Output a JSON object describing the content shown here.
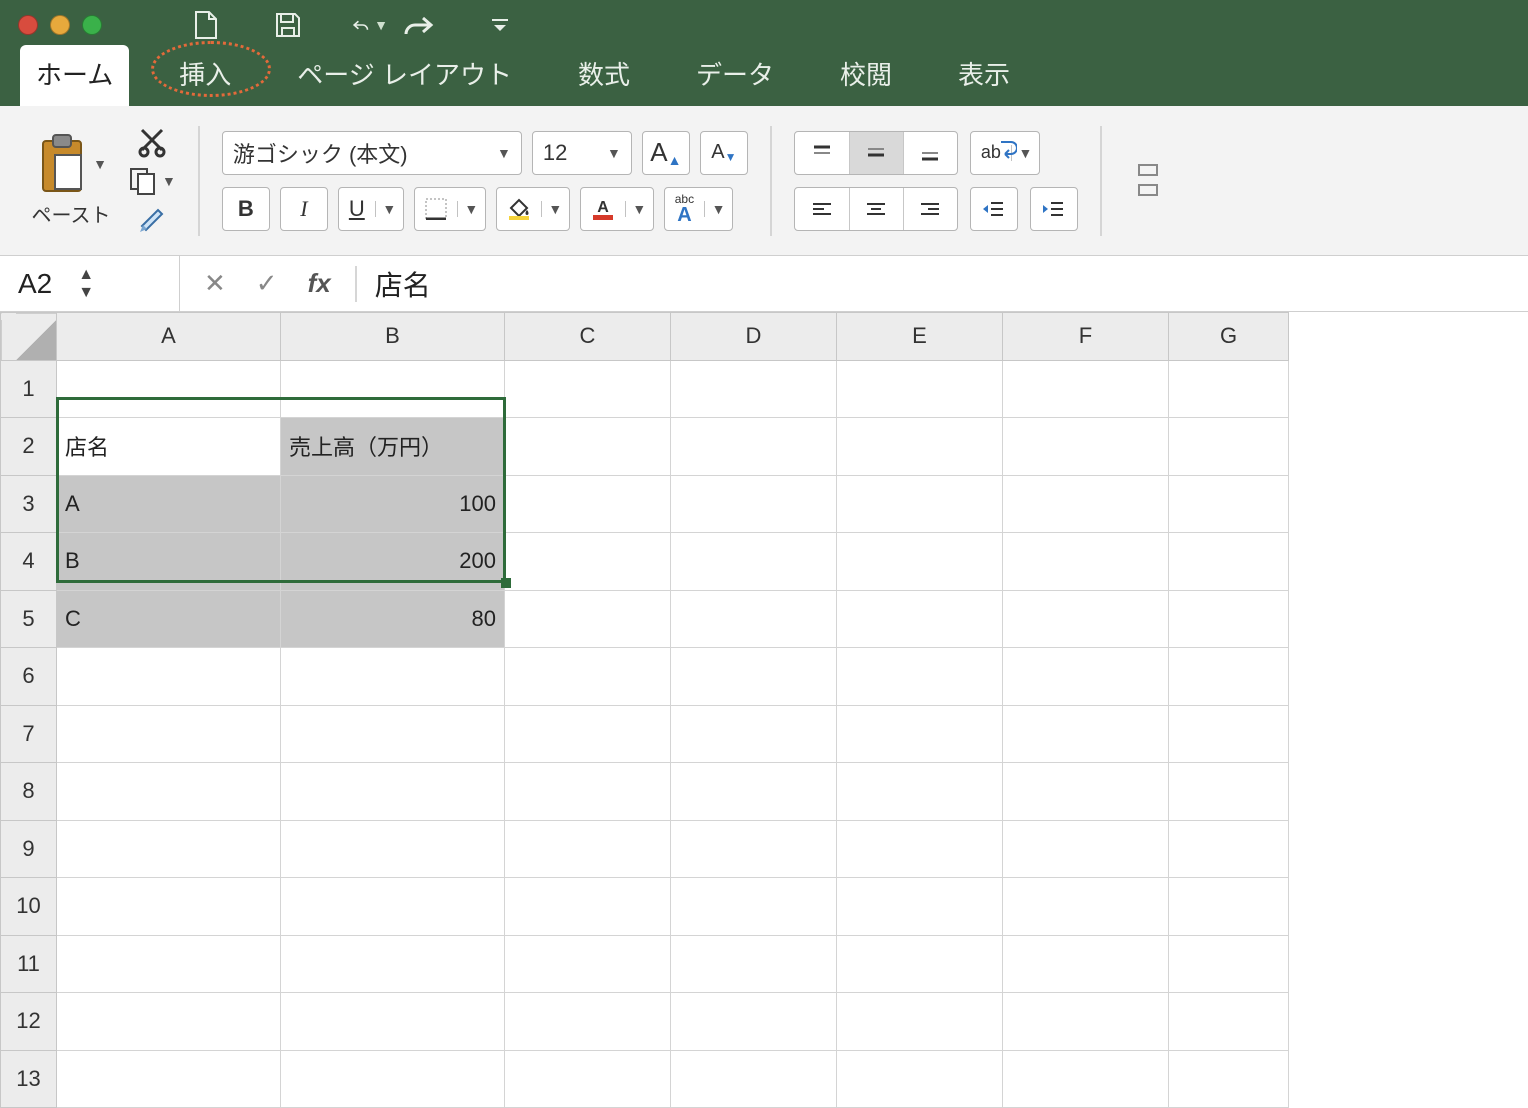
{
  "quick_access": {
    "new_icon": "new-file",
    "save_icon": "save",
    "undo_icon": "undo",
    "redo_icon": "redo",
    "customize_icon": "customize"
  },
  "tabs": {
    "home": "ホーム",
    "insert": "挿入",
    "page_layout": "ページ レイアウト",
    "formulas": "数式",
    "data": "データ",
    "review": "校閲",
    "view": "表示"
  },
  "ribbon": {
    "paste_label": "ペースト",
    "font_name": "游ゴシック (本文)",
    "font_size": "12",
    "bold": "B",
    "italic": "I",
    "underline": "U",
    "grow_font": "A",
    "shrink_font": "A",
    "phonetic": "abc",
    "phonetic_sub": "A",
    "wrap_text": "ab"
  },
  "name_box": "A2",
  "formula_bar": "店名",
  "columns": [
    "A",
    "B",
    "C",
    "D",
    "E",
    "F",
    "G"
  ],
  "rows": [
    "1",
    "2",
    "3",
    "4",
    "5",
    "6",
    "7",
    "8",
    "9",
    "10",
    "11",
    "12",
    "13"
  ],
  "selection": {
    "from": "A2",
    "to": "B5",
    "active": "A2"
  },
  "cells": {
    "A2": "店名",
    "B2": "売上高（万円）",
    "A3": "A",
    "B3": "100",
    "A4": "B",
    "B4": "200",
    "A5": "C",
    "B5": "80"
  },
  "chart_data": {
    "type": "table",
    "title": "",
    "columns": [
      "店名",
      "売上高（万円）"
    ],
    "rows": [
      [
        "A",
        100
      ],
      [
        "B",
        200
      ],
      [
        "C",
        80
      ]
    ]
  }
}
